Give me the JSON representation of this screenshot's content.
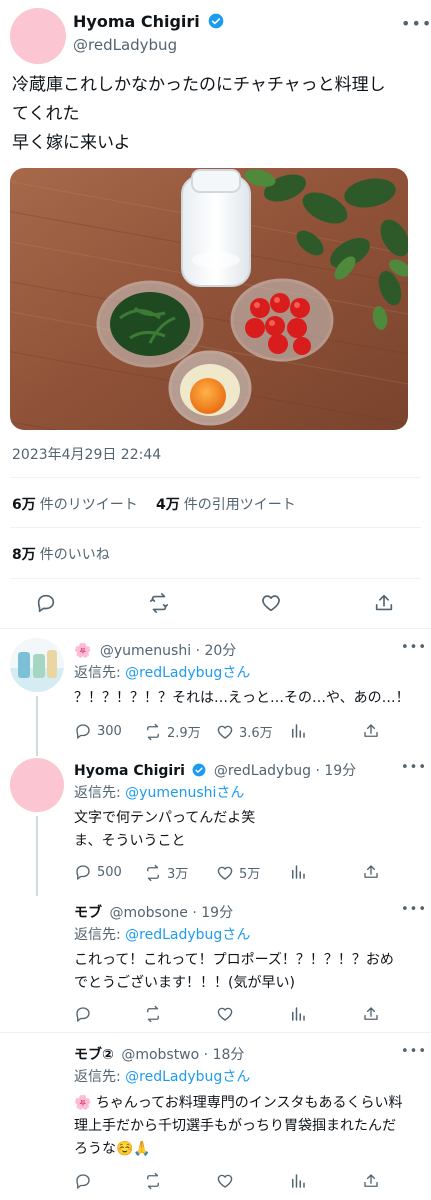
{
  "main_tweet": {
    "display_name": "Hyoma Chigiri",
    "handle": "@redLadybug",
    "text_line1": "冷蔵庫これしかなかったのにチャチャっと料理し",
    "text_line2": "てくれた",
    "text_line3": "早く嫁に来いよ",
    "timestamp": "2023年4月29日 22:44",
    "retweets_count": "6万",
    "retweets_label": "件のリツイート",
    "quotes_count": "4万",
    "quotes_label": "件の引用ツイート",
    "likes_count": "8万",
    "likes_label": "件のいいね"
  },
  "replies": [
    {
      "emoji": "🌸",
      "handle": "@yumenushi",
      "time": "20分",
      "reply_to_label": "返信先:",
      "reply_to_handle": "@redLadybugさん",
      "body": "？！？！？！？それは…えっと…その…や、あの…！",
      "replies": "300",
      "retweets": "2.9万",
      "likes": "3.6万"
    },
    {
      "display_name": "Hyoma Chigiri",
      "handle": "@redLadybug",
      "time": "19分",
      "reply_to_label": "返信先:",
      "reply_to_handle": "@yumenushiさん",
      "body_line1": "文字で何テンパってんだよ笑",
      "body_line2": "ま、そういうこと",
      "replies": "500",
      "retweets": "3万",
      "likes": "5万"
    },
    {
      "display_name": "モブ",
      "handle": "@mobsone",
      "time": "19分",
      "reply_to_label": "返信先:",
      "reply_to_handle": "@redLadybugさん",
      "body_line1": "これって！これって！プロポーズ！？！？！？おめ",
      "body_line2": "でとうございます！！！(気が早い)"
    },
    {
      "display_name": "モブ②",
      "handle": "@mobstwo",
      "time": "18分",
      "reply_to_label": "返信先:",
      "reply_to_handle": "@redLadybugさん",
      "body_line1": "🌸 ちゃんってお料理専門のインスタもあるくらい料",
      "body_line2": "理上手だから千切選手もがっちり胃袋掴まれたんだ",
      "body_line3": "ろうな☺️🙏"
    }
  ],
  "colors": {
    "accent": "#1d9bf0",
    "avatar_pink": "#fbc5d2",
    "muted": "#536471"
  }
}
